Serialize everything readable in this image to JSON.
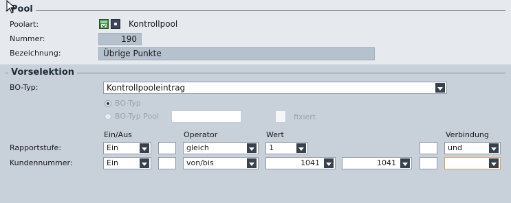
{
  "pool": {
    "title": "Pool",
    "poolart_label": "Poolart:",
    "poolart_value": "Kontrollpool",
    "nummer_label": "Nummer:",
    "nummer_value": "190",
    "bezeichnung_label": "Bezeichnung:",
    "bezeichnung_value": "Übrige Punkte"
  },
  "vorselektion": {
    "title": "Vorselektion",
    "bo_typ_label": "BO-Typ:",
    "bo_typ_value": "Kontrollpooleintrag",
    "radio_bo_typ": "BO-Typ",
    "radio_bo_typ_pool": "BO-Typ Pool",
    "bo_typ_pool_value": "",
    "fixiert_label": "fixiert"
  },
  "grid": {
    "headers": {
      "ein_aus": "Ein/Aus",
      "operator": "Operator",
      "wert": "Wert",
      "verbindung": "Verbindung"
    },
    "rows": [
      {
        "label": "Rapportstufe:",
        "ein_aus": "Ein",
        "operator": "gleich",
        "wert": "1",
        "verbindung": "und"
      },
      {
        "label": "Kundennummer:",
        "ein_aus": "Ein",
        "operator": "von/bis",
        "wert_von": "1041",
        "wert_bis": "1041",
        "verbindung": ""
      }
    ]
  },
  "colors": {
    "background": "#c8d0da",
    "pool_background": "#e6e9ee",
    "readonly_field": "#b6c1ce",
    "dropdown_button": "#39424c",
    "focus_border": "#e0a060"
  },
  "icons": {
    "poolart_icon_1": "pool-type-icon",
    "poolart_icon_2": "pool-select-icon",
    "dropdown": "chevron-down-icon",
    "cursor": "mouse-cursor-icon"
  }
}
